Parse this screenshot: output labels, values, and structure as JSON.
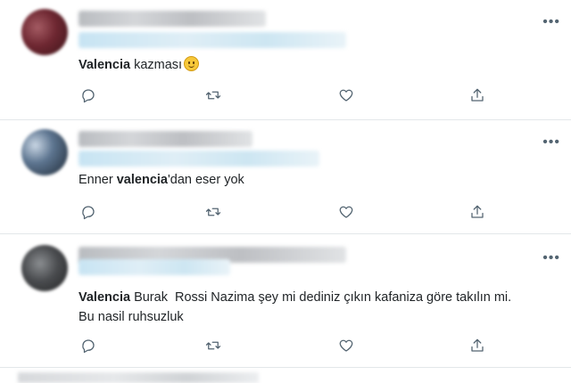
{
  "tweets": [
    {
      "text_parts": [
        {
          "text": "Valencia",
          "bold": true
        },
        {
          "text": " kazması",
          "bold": false
        }
      ],
      "emoji": "grinning-face"
    },
    {
      "text_parts": [
        {
          "text": "Enner ",
          "bold": false
        },
        {
          "text": "valencia",
          "bold": true
        },
        {
          "text": "'dan eser yok",
          "bold": false
        }
      ]
    },
    {
      "line1_parts": [
        {
          "text": "Valencia",
          "bold": true
        },
        {
          "text": " Burak  Rossi Nazima şey mi dediniz çıkın kafaniza göre takılın mi.",
          "bold": false
        }
      ],
      "line2": "Bu nasil ruhsuzluk"
    }
  ],
  "icons": [
    "reply-icon",
    "retweet-icon",
    "like-icon",
    "share-icon",
    "more-icon"
  ],
  "colors": {
    "icon": "#536471",
    "divider": "#e3e7ea",
    "text": "#0f1419"
  }
}
